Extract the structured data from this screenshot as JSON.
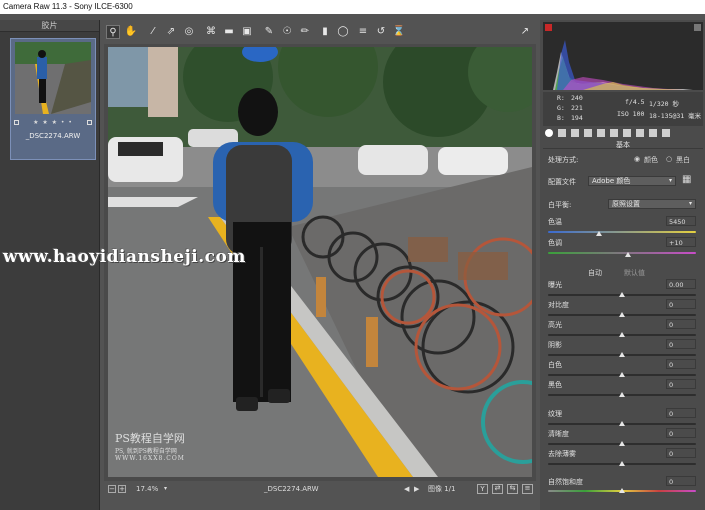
{
  "window": {
    "title": "Camera Raw 11.3 -  Sony ILCE-6300"
  },
  "filmstrip": {
    "header": "胶片",
    "items": [
      {
        "name": "_DSC2274.ARW",
        "stars": "★ ★ ★ • •"
      }
    ]
  },
  "toolbar": {
    "tools": [
      "zoom-icon",
      "hand-icon",
      "white-balance-icon",
      "color-sampler-icon",
      "targeted-adjust-icon",
      "crop-icon",
      "straighten-icon",
      "transform-icon",
      "spot-removal-icon",
      "red-eye-icon",
      "adjustment-brush-icon",
      "graduated-filter-icon",
      "radial-filter-icon",
      "presets-icon",
      "rotate-ccw-icon",
      "rotate-cw-icon"
    ],
    "toggle_icon": "fullscreen-icon"
  },
  "preview": {
    "filename": "_DSC2274.ARW"
  },
  "statusbar": {
    "zoom": "17.4%",
    "filename": "_DSC2274.ARW",
    "image_label": "图像 1/1",
    "y_button": "Y"
  },
  "info": {
    "r_label": "R:",
    "r_value": "240",
    "g_label": "G:",
    "g_value": "221",
    "b_label": "B:",
    "b_value": "194",
    "aperture": "f/4.5",
    "shutter": "1/320 秒",
    "iso": "ISO 100",
    "lens": "18-135@31 毫米"
  },
  "basic": {
    "title": "基本",
    "treatment_label": "处理方式:",
    "color_option": "颜色",
    "bw_option": "黑白",
    "profile_label": "配置文件",
    "profile_value": "Adobe 颜色",
    "wb_label": "白平衡:",
    "wb_value": "原照设置",
    "temp_label": "色温",
    "temp_value": "5450",
    "tint_label": "色调",
    "tint_value": "+10",
    "auto_label": "自动",
    "default_label": "默认值",
    "sliders": [
      {
        "label": "曝光",
        "value": "0.00"
      },
      {
        "label": "对比度",
        "value": "0"
      },
      {
        "label": "高光",
        "value": "0"
      },
      {
        "label": "阴影",
        "value": "0"
      },
      {
        "label": "白色",
        "value": "0"
      },
      {
        "label": "黑色",
        "value": "0"
      },
      {
        "label": "纹理",
        "value": "0"
      },
      {
        "label": "清晰度",
        "value": "0"
      },
      {
        "label": "去除薄雾",
        "value": "0"
      },
      {
        "label": "自然饱和度",
        "value": "0"
      }
    ]
  },
  "watermark": {
    "site": "www.haoyidiansheji.com",
    "logo_title": "PS教程自学网",
    "logo_sub": "PS, 就到PS教程自学网",
    "logo_url": "WWW.16XX8.COM"
  },
  "colors": {
    "accent_selection": "#7c90b8",
    "panel_bg": "#4b4b4b",
    "curb_yellow": "#e8b21f"
  }
}
